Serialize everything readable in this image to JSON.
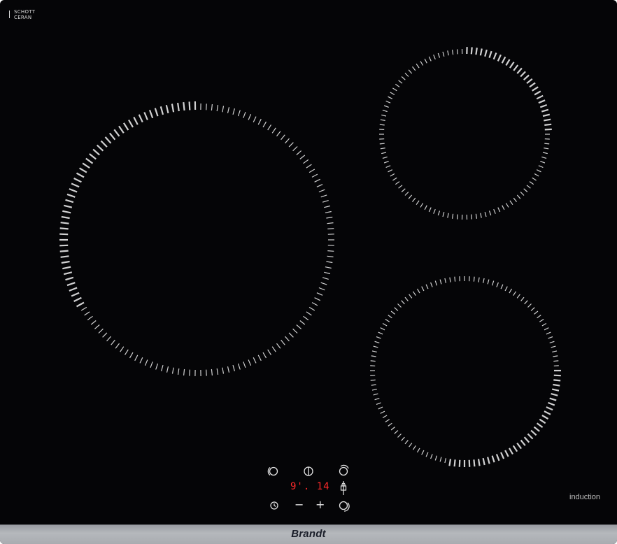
{
  "brand": {
    "name": "Brandt"
  },
  "glass_logo": {
    "line1": "SCHOTT",
    "line2": "CERAN"
  },
  "hob": {
    "technology_label": "induction",
    "cooking_zones": [
      {
        "name": "large-left"
      },
      {
        "name": "top-right"
      },
      {
        "name": "bottom-right"
      }
    ]
  },
  "control_panel": {
    "timer_display": "9'. 14",
    "icons": [
      "zone-left-select-icon",
      "power-icon",
      "zone-top-right-select-icon",
      "lock-icon",
      "timer-icon",
      "minus-icon",
      "plus-icon",
      "zone-bottom-right-select-icon"
    ],
    "minus_symbol": "−",
    "plus_symbol": "+"
  },
  "colors": {
    "glass": "#050507",
    "zone_marks": "#e8e8e8",
    "display_red": "#ff2a2a",
    "frame": "#b5b8bc"
  }
}
